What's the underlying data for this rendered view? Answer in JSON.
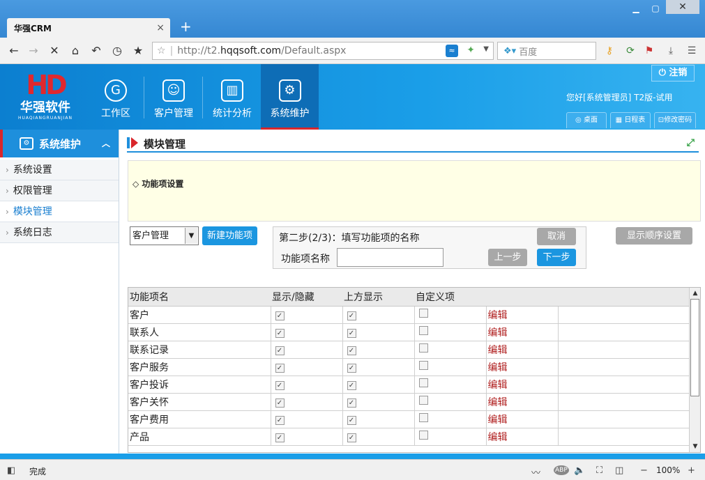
{
  "browser": {
    "tab_title": "华强CRM",
    "tab_close": "×",
    "new_tab": "+",
    "url_prefix": "http://t2.",
    "url_host": "hqqsoft.com",
    "url_path": "/Default.aspx",
    "search_placeholder": "百度",
    "status_text": "完成",
    "zoom": "100%"
  },
  "header": {
    "logo_mark": "HD",
    "logo_text": "华强软件",
    "logo_pinyin": "HUAQIANGRUANJIAN",
    "nav": [
      {
        "label": "工作区"
      },
      {
        "label": "客户管理"
      },
      {
        "label": "统计分析"
      },
      {
        "label": "系统维护"
      }
    ],
    "logout_label": "注销",
    "greeting": "您好[系统管理员] T2版-试用",
    "buttons": [
      {
        "label": "桌面"
      },
      {
        "label": "日程表"
      },
      {
        "label": "修改密码"
      }
    ]
  },
  "sidebar": {
    "title": "系统维护",
    "items": [
      {
        "label": "系统设置"
      },
      {
        "label": "权限管理"
      },
      {
        "label": "模块管理"
      },
      {
        "label": "系统日志"
      }
    ]
  },
  "content": {
    "title": "模块管理",
    "note": "◇ 功能项设置",
    "select_value": "客户管理",
    "new_button": "新建功能项",
    "step_text": "第二步(2/3)：填写功能项的名称",
    "cancel": "取消",
    "prev": "上一步",
    "next": "下一步",
    "name_label": "功能项名称",
    "name_value": "",
    "order_button": "显示顺序设置"
  },
  "grid": {
    "headers": [
      "功能项名",
      "显示/隐藏",
      "上方显示",
      "自定义项",
      "",
      ""
    ],
    "edit_label": "编辑",
    "rows": [
      {
        "name": "客户",
        "show": true,
        "top": true,
        "custom": false
      },
      {
        "name": "联系人",
        "show": true,
        "top": true,
        "custom": false
      },
      {
        "name": "联系记录",
        "show": true,
        "top": true,
        "custom": false
      },
      {
        "name": "客户服务",
        "show": true,
        "top": true,
        "custom": false
      },
      {
        "name": "客户投诉",
        "show": true,
        "top": true,
        "custom": false
      },
      {
        "name": "客户关怀",
        "show": true,
        "top": true,
        "custom": false
      },
      {
        "name": "客户费用",
        "show": true,
        "top": true,
        "custom": false
      },
      {
        "name": "产品",
        "show": true,
        "top": true,
        "custom": false
      }
    ]
  }
}
